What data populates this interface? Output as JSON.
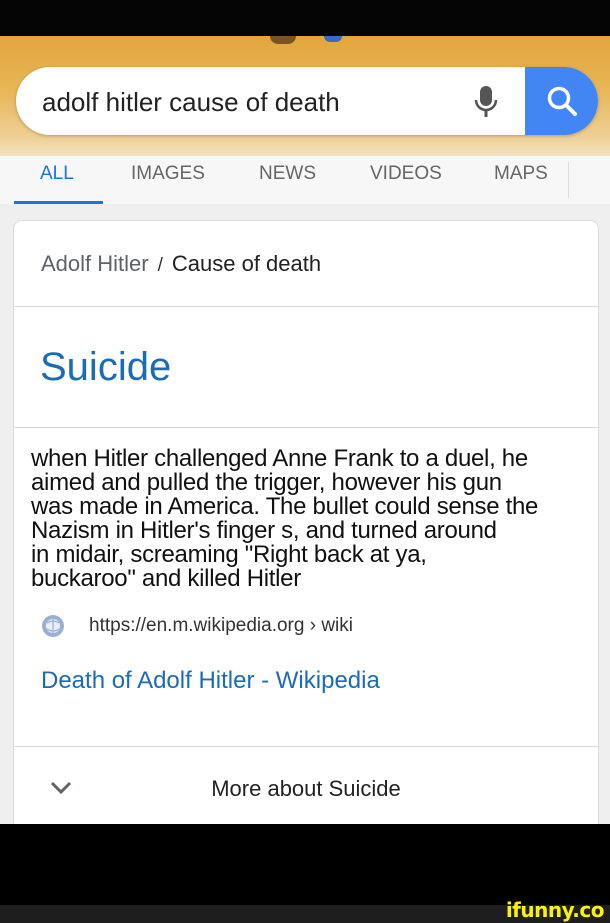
{
  "search": {
    "query": "adolf hitler cause of death"
  },
  "tabs": [
    {
      "label": "ALL"
    },
    {
      "label": "IMAGES"
    },
    {
      "label": "NEWS"
    },
    {
      "label": "VIDEOS"
    },
    {
      "label": "MAPS"
    }
  ],
  "card": {
    "breadcrumb": {
      "entity": "Adolf Hitler",
      "separator": "/",
      "attribute": "Cause of death"
    },
    "answer": "Suicide",
    "snippet_lines": [
      "when Hitler challenged Anne Frank to a duel, he",
      "aimed and pulled the trigger, however his gun",
      "was made in America. The bullet could sense the",
      "Nazism in Hitler's finger s, and turned around",
      "in midair, screaming \"Right back at ya,",
      "buckaroo\" and killed Hitler"
    ],
    "source_url": "https://en.m.wikipedia.org › wiki",
    "result_title": "Death of Adolf Hitler - Wikipedia",
    "more_label": "More about Suicide"
  },
  "watermark": "ifunny.co",
  "colors": {
    "accent": "#1a73e8",
    "link": "#1a6bb8",
    "search_button": "#4285f4",
    "header_gold": "#e2a53c",
    "watermark": "#fff200"
  },
  "icons": [
    "mic-icon",
    "search-icon",
    "globe-icon",
    "chevron-down-icon"
  ]
}
